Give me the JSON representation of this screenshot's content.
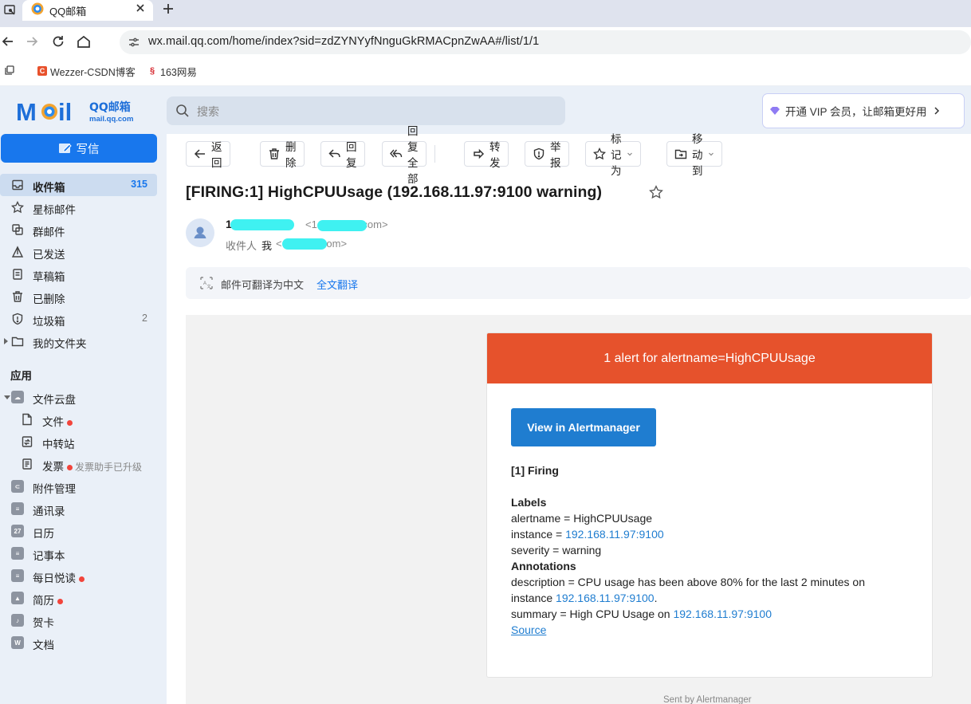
{
  "browser": {
    "tab_title": "QQ邮箱",
    "url": "wx.mail.qq.com/home/index?sid=zdZYNYyfNnguGkRMACpnZwAA#/list/1/1",
    "bookmarks": [
      {
        "label": "Wezzer-CSDN博客",
        "icon": "csdn-favicon",
        "color": "#e8512c"
      },
      {
        "label": "163网易",
        "icon": "163-favicon",
        "color": "#d6262d"
      }
    ]
  },
  "header": {
    "logo_main": "MOil",
    "logo_cn": "QQ邮箱",
    "logo_url": "mail.qq.com",
    "search_placeholder": "搜索",
    "vip_text": "开通 VIP 会员，让邮箱更好用"
  },
  "sidebar": {
    "compose_label": "写信",
    "folders": [
      {
        "label": "收件箱",
        "count": "315",
        "icon": "inbox-icon"
      },
      {
        "label": "星标邮件",
        "count": "",
        "icon": "star-icon"
      },
      {
        "label": "群邮件",
        "count": "",
        "icon": "group-mail-icon"
      },
      {
        "label": "已发送",
        "count": "",
        "icon": "sent-icon"
      },
      {
        "label": "草稿箱",
        "count": "",
        "icon": "draft-icon"
      },
      {
        "label": "已删除",
        "count": "",
        "icon": "trash-icon"
      },
      {
        "label": "垃圾箱",
        "count": "2",
        "icon": "spam-icon"
      },
      {
        "label": "我的文件夹",
        "count": "",
        "icon": "folder-icon"
      }
    ],
    "apps_heading": "应用",
    "cloud": {
      "label": "文件云盘",
      "children": [
        {
          "label": "文件",
          "dot": true,
          "note": ""
        },
        {
          "label": "中转站",
          "dot": false,
          "note": ""
        },
        {
          "label": "发票",
          "dot": true,
          "note": "发票助手已升级"
        }
      ]
    },
    "apps": [
      {
        "label": "附件管理",
        "dot": false,
        "icon": "attachment-icon"
      },
      {
        "label": "通讯录",
        "dot": false,
        "icon": "contacts-icon"
      },
      {
        "label": "日历",
        "dot": false,
        "icon": "calendar-icon",
        "glyph": "27"
      },
      {
        "label": "记事本",
        "dot": false,
        "icon": "notepad-icon"
      },
      {
        "label": "每日悦读",
        "dot": true,
        "icon": "reading-icon"
      },
      {
        "label": "简历",
        "dot": true,
        "icon": "resume-icon"
      },
      {
        "label": "贺卡",
        "dot": false,
        "icon": "greeting-card-icon"
      },
      {
        "label": "文档",
        "dot": false,
        "icon": "docs-icon",
        "glyph": "W"
      }
    ]
  },
  "toolbar": {
    "back": "返回",
    "delete": "删除",
    "reply": "回复",
    "reply_all": "回复全部",
    "forward": "转发",
    "report": "举报",
    "mark_as": "标记为",
    "move_to": "移动到"
  },
  "message": {
    "subject": "[FIRING:1] HighCPUUsage (192.168.11.97:9100 warning)",
    "sender_name": "1          36",
    "sender_email": "<1          36@163.com>",
    "recipient_label": "收件人",
    "recipient_me": "我",
    "recipient_email": "<          26@qq.com>",
    "translate_text": "邮件可翻译为中文",
    "translate_link": "全文翻译"
  },
  "alert": {
    "header": "1 alert for alertname=HighCPUUsage",
    "button": "View in Alertmanager",
    "firing": "[1] Firing",
    "labels_heading": "Labels",
    "alertname_line": "alertname = HighCPUUsage",
    "instance_prefix": "instance = ",
    "instance": "192.168.11.97:9100",
    "severity_line": "severity = warning",
    "annotations_heading": "Annotations",
    "description_line1": "description = CPU usage has been above 80% for the last 2 minutes on",
    "description_prefix2": "instance ",
    "description_host": "192.168.11.97:9100",
    "description_suffix": ".",
    "summary_prefix": "summary = High CPU Usage on ",
    "summary_host": "192.168.11.97:9100",
    "source": "Source",
    "footer": "Sent by Alertmanager"
  },
  "colors": {
    "accent": "#1877ed",
    "alert_header": "#e6522c",
    "alert_button": "#1f7dd0"
  }
}
